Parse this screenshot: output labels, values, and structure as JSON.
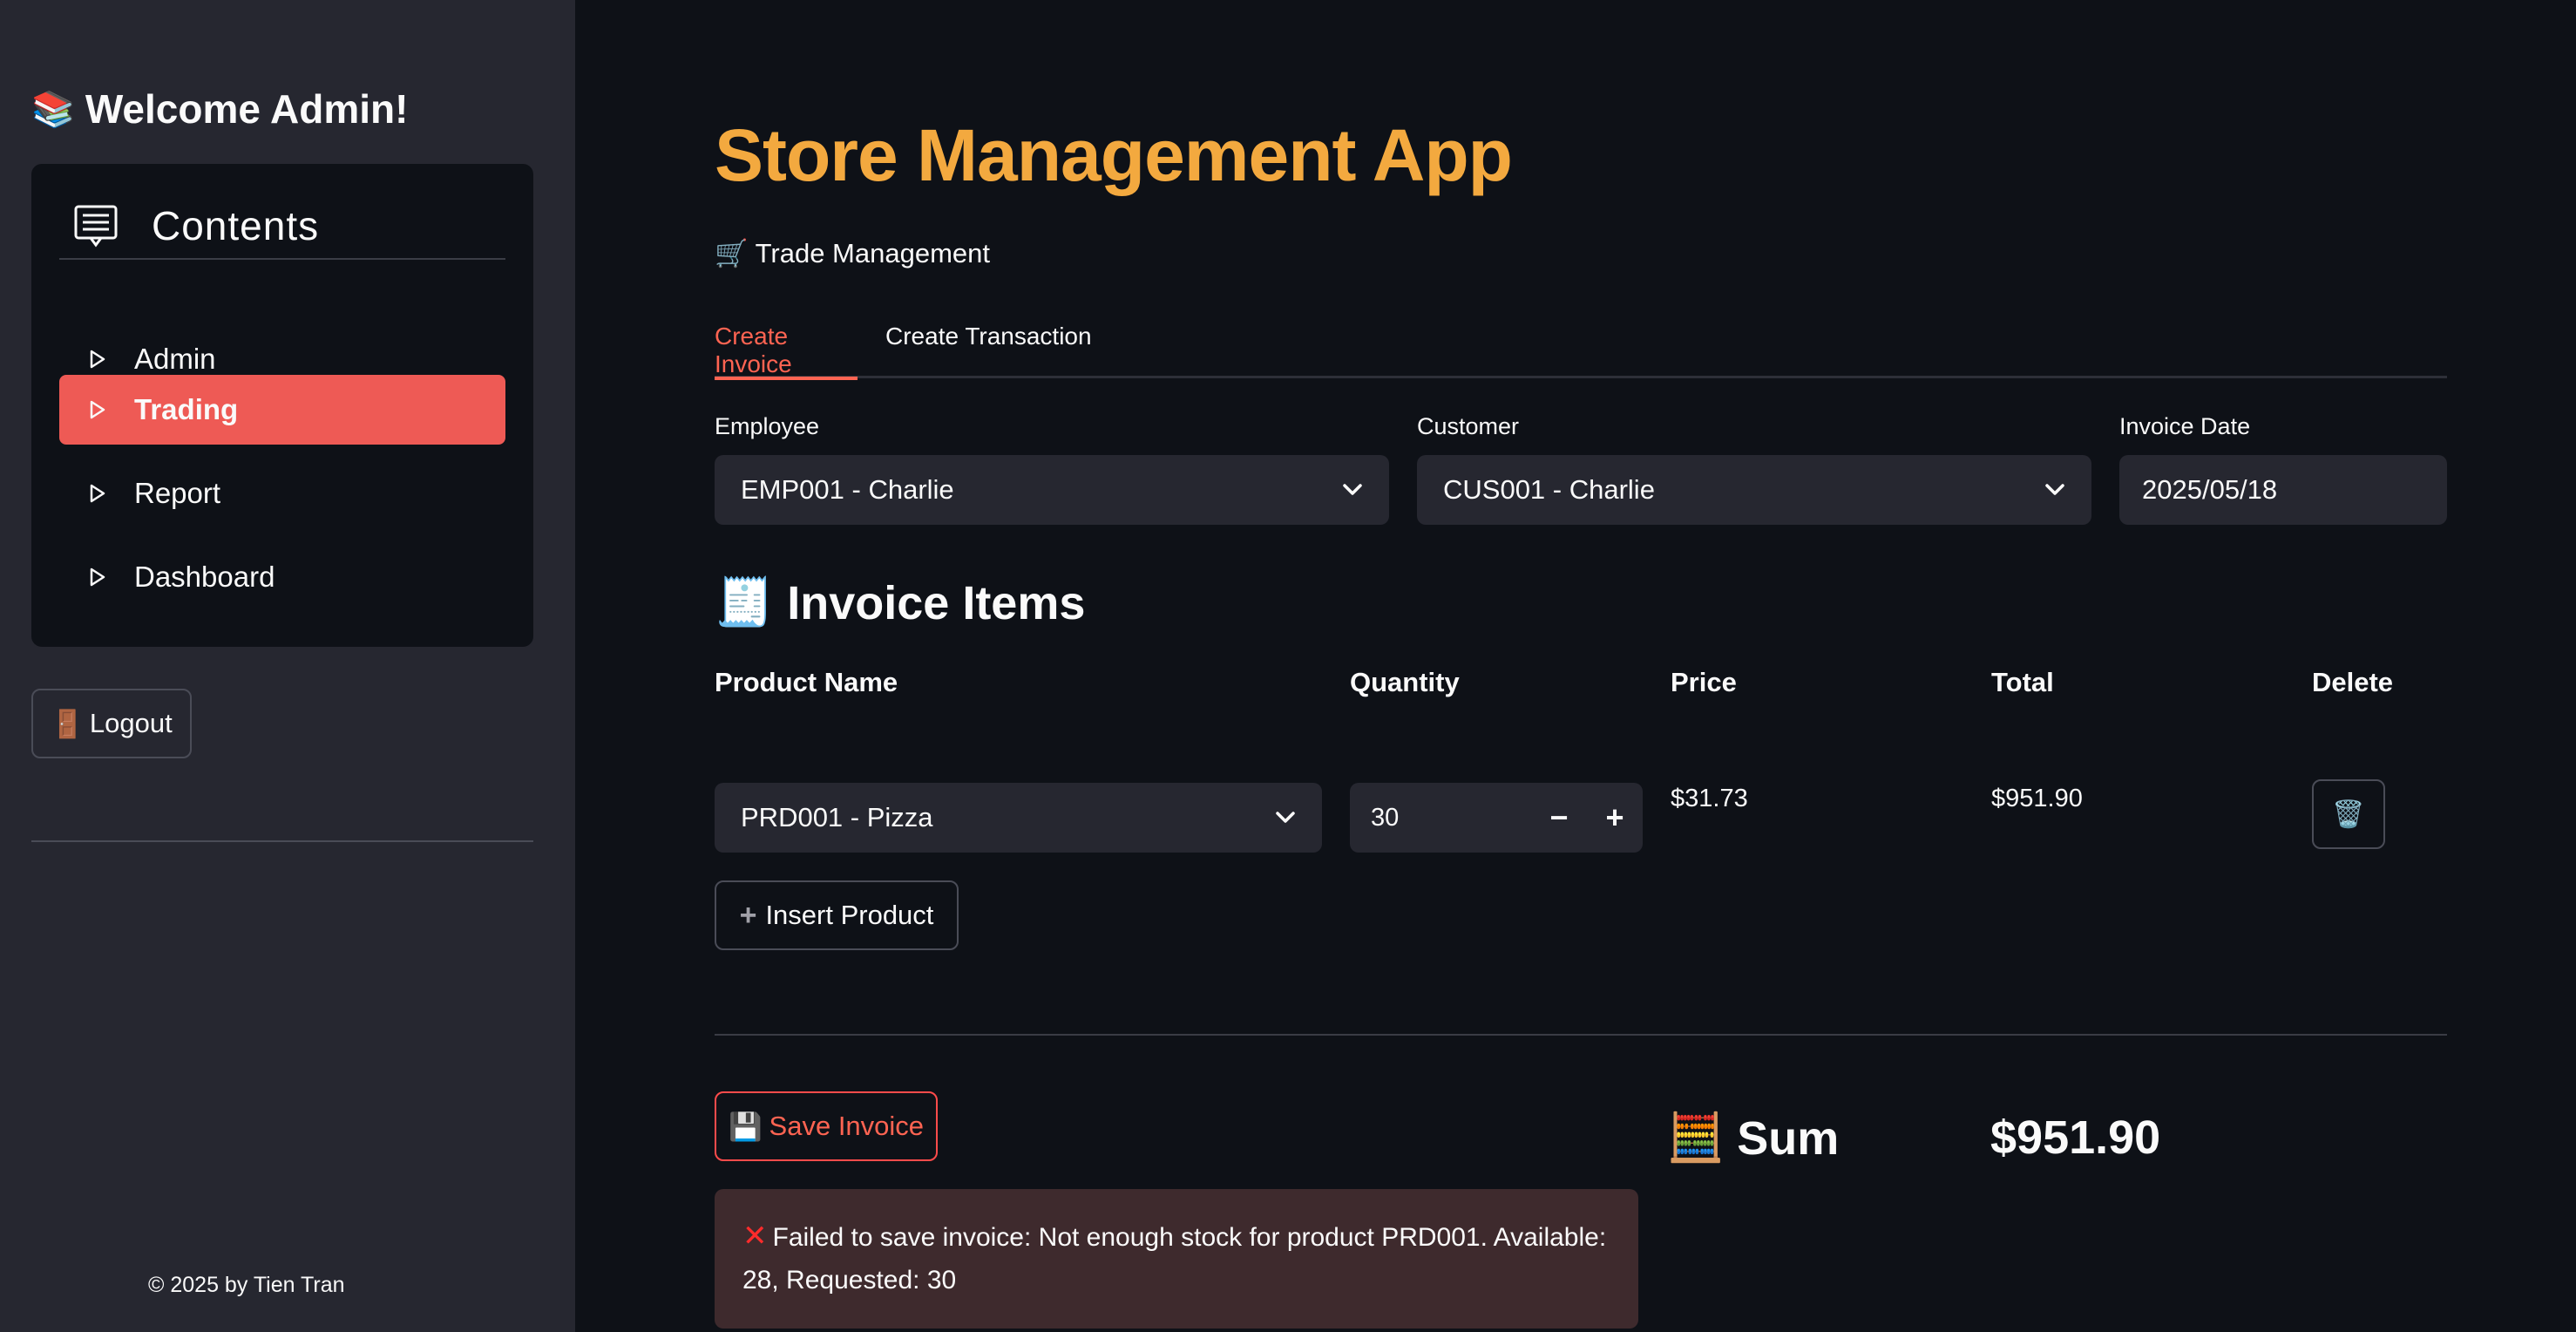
{
  "sidebar": {
    "welcome": "Welcome Admin!",
    "welcome_icon": "books-icon",
    "menu_title": "Contents",
    "menu_items": [
      {
        "label": "Admin",
        "active": false
      },
      {
        "label": "Trading",
        "active": true
      },
      {
        "label": "Report",
        "active": false
      },
      {
        "label": "Dashboard",
        "active": false
      }
    ],
    "logout_label": "Logout",
    "copyright": "© 2025 by Tien Tran"
  },
  "main": {
    "app_title": "Store Management App",
    "subtitle": "Trade Management",
    "tabs": [
      {
        "label": "Create Invoice",
        "active": true
      },
      {
        "label": "Create Transaction",
        "active": false
      }
    ],
    "employee": {
      "label": "Employee",
      "value": "EMP001 - Charlie"
    },
    "customer": {
      "label": "Customer",
      "value": "CUS001 - Charlie"
    },
    "invoice_date": {
      "label": "Invoice Date",
      "value": "2025/05/18"
    },
    "invoice_items_title": "Invoice Items",
    "columns": [
      "Product Name",
      "Quantity",
      "Price",
      "Total",
      "Delete"
    ],
    "items": [
      {
        "product": "PRD001 - Pizza",
        "quantity": "30",
        "price": "$31.73",
        "total": "$951.90"
      }
    ],
    "insert_product_label": "Insert Product",
    "save_invoice_label": "Save Invoice",
    "sum_label": "Sum",
    "sum_value": "$951.90",
    "error_message": "Failed to save invoice: Not enough stock for product PRD001. Available: 28, Requested: 30"
  },
  "colors": {
    "accent": "#ee5a55",
    "title": "#f3a93f",
    "background": "#0e1117",
    "sidebar": "#262730",
    "error_bg": "#3e2a2d"
  }
}
